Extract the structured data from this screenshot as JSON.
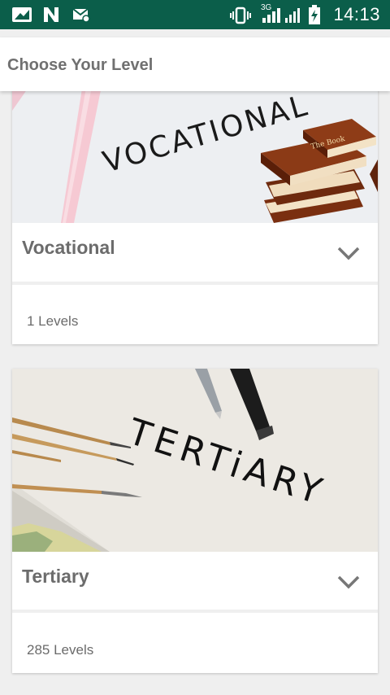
{
  "status_bar": {
    "time": "14:13",
    "left_icons": [
      "gallery-icon",
      "n-app-icon",
      "mail-icon"
    ],
    "right_icons": [
      "vibrate-icon",
      "signal-3g-icon",
      "signal-icon",
      "battery-charging-icon"
    ],
    "network_label": "3G"
  },
  "app_bar": {
    "title": "Choose Your Level"
  },
  "cards": [
    {
      "title": "Vocational",
      "levels": "1 Levels",
      "image_text": "VOCATIONAL",
      "book_label": "The Book",
      "expand_icon": "chevron-down-icon"
    },
    {
      "title": "Tertiary",
      "levels": "285 Levels",
      "image_text": "TERTiARY",
      "expand_icon": "chevron-down-icon"
    }
  ],
  "colors": {
    "status_bar": "#0b5e4a",
    "background": "#efefef",
    "card": "#ffffff",
    "title_text": "#6c6c6c",
    "book_brown": "#8b3a16"
  }
}
